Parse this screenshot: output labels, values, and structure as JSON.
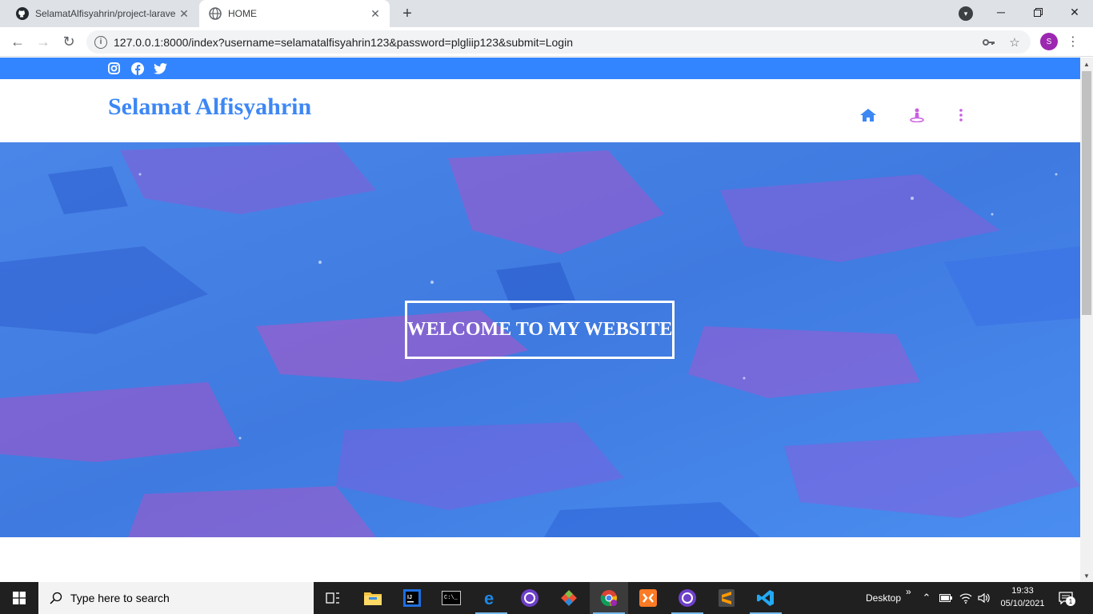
{
  "browser": {
    "tabs": [
      {
        "title": "SelamatAlfisyahrin/project-larave",
        "icon": "github-icon",
        "active": false
      },
      {
        "title": "HOME",
        "icon": "globe-icon",
        "active": true
      }
    ],
    "url": "127.0.0.1:8000/index?username=selamatalfisyahrin123&password=plgliip123&submit=Login",
    "profile_initial": "S"
  },
  "page": {
    "social_icons": [
      "instagram-icon",
      "facebook-icon",
      "twitter-icon"
    ],
    "brand": "Selamat Alfisyahrin",
    "menu_icons": [
      "home-icon",
      "person-icon",
      "more-vertical-icon"
    ],
    "hero_title": "WELCOME TO MY WEBSITE",
    "colors": {
      "topbar": "#3385ff",
      "brand": "#3d87f5",
      "menu_home": "#3d87f5",
      "menu_other": "#c95fe0"
    }
  },
  "taskbar": {
    "search_placeholder": "Type here to search",
    "apps": [
      "task-view-icon",
      "file-explorer-icon",
      "intellij-icon",
      "terminal-icon",
      "edge-icon",
      "github-desktop-icon",
      "git-icon",
      "chrome-icon",
      "xampp-icon",
      "github-desktop-icon",
      "sublime-text-icon",
      "vscode-icon"
    ],
    "desktop_label": "Desktop",
    "chevron": "»",
    "time": "19:33",
    "date": "05/10/2021",
    "notification_count": "1"
  }
}
